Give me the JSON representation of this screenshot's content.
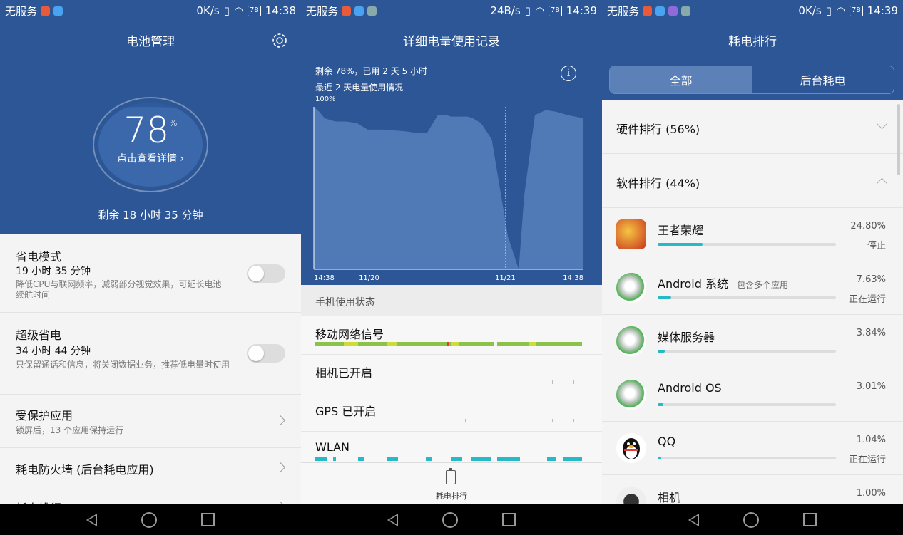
{
  "panel1": {
    "status": {
      "carrier": "无服务",
      "speed": "0K/s",
      "battery": "78",
      "time": "14:38"
    },
    "title": "电池管理",
    "percent": "78",
    "percent_unit": "%",
    "detail": "点击查看详情 ›",
    "remaining": "剩余 18 小时 35 分钟",
    "items": [
      {
        "title": "省电模式",
        "time": "19 小时 35 分钟",
        "desc": "降低CPU与联网频率，减弱部分视觉效果，可延长电池续航时间"
      },
      {
        "title": "超级省电",
        "time": "34 小时 44 分钟",
        "desc": "只保留通话和信息，将关闭数据业务，推荐低电量时使用"
      },
      {
        "title": "受保护应用",
        "desc": "锁屏后，13 个应用保持运行"
      },
      {
        "title": "耗电防火墙 (后台耗电应用)"
      },
      {
        "title": "耗电排行"
      }
    ]
  },
  "panel2": {
    "status": {
      "carrier": "无服务",
      "speed": "24B/s",
      "battery": "78",
      "time": "14:39"
    },
    "title": "详细电量使用记录",
    "summary": "剩余 78%，已用 2 天 5 小时",
    "subtitle": "最近 2 天电量使用情况",
    "info": "i",
    "section": "手机使用状态",
    "rows": [
      "移动网络信号",
      "相机已开启",
      "GPS 已开启",
      "WLAN"
    ],
    "bottom_tab": "耗电排行"
  },
  "chart_data": {
    "type": "area",
    "ylabel_top": "100%",
    "x_ticks": [
      "14:38",
      "11/20",
      "11/21",
      "14:38"
    ],
    "x": [
      0,
      2,
      4,
      6,
      8,
      12,
      16,
      18,
      20,
      26,
      34,
      38,
      42,
      46,
      49,
      51,
      55,
      57,
      59,
      62,
      66,
      68,
      72,
      76,
      78,
      82,
      86,
      90,
      94,
      100
    ],
    "values": [
      100,
      97,
      93,
      92,
      91,
      91,
      90,
      88,
      86,
      86,
      85,
      84,
      84,
      95,
      95,
      94,
      94,
      94,
      93,
      90,
      80,
      60,
      20,
      0,
      45,
      95,
      98,
      97,
      95,
      93
    ],
    "ylim": [
      0,
      100
    ],
    "color_fill": "#4f7ab5",
    "color_bg": "#2c5695"
  },
  "panel3": {
    "status": {
      "carrier": "无服务",
      "speed": "0K/s",
      "battery": "78",
      "time": "14:39"
    },
    "title": "耗电排行",
    "tabs": [
      "全部",
      "后台耗电"
    ],
    "categories": [
      "硬件排行 (56%)",
      "软件排行 (44%)"
    ],
    "apps": [
      {
        "name": "王者荣耀",
        "sub": "",
        "percent": "24.80%",
        "value": 24.8,
        "status": "停止",
        "icon": "game-icon"
      },
      {
        "name": "Android 系统",
        "sub": "包含多个应用",
        "percent": "7.63%",
        "value": 7.63,
        "status": "正在运行",
        "icon": "android-system-icon"
      },
      {
        "name": "媒体服务器",
        "sub": "",
        "percent": "3.84%",
        "value": 3.84,
        "status": "",
        "icon": "media-server-icon"
      },
      {
        "name": "Android OS",
        "sub": "",
        "percent": "3.01%",
        "value": 3.01,
        "status": "",
        "icon": "android-os-icon"
      },
      {
        "name": "QQ",
        "sub": "",
        "percent": "1.04%",
        "value": 1.04,
        "status": "正在运行",
        "icon": "qq-penguin-icon"
      },
      {
        "name": "相机",
        "sub": "",
        "percent": "1.00%",
        "value": 1.0,
        "status": "",
        "icon": "camera-icon"
      }
    ]
  },
  "colors": {
    "brand": "#2c5695",
    "accent": "#26b9c6"
  }
}
